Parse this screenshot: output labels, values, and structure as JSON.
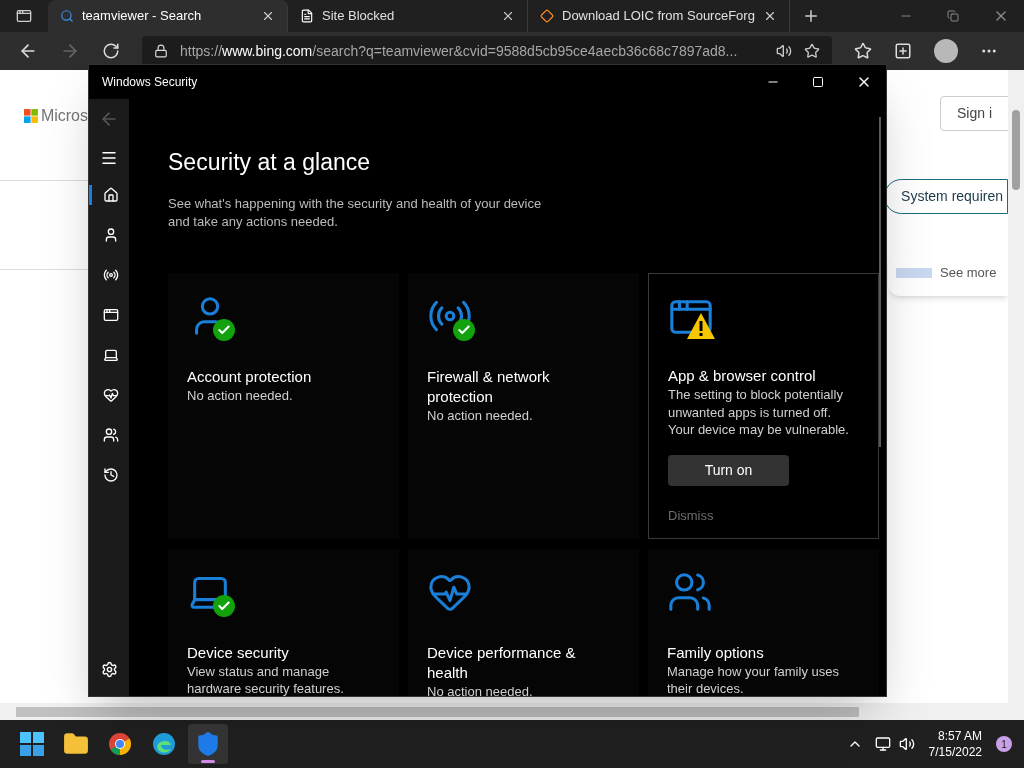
{
  "browser": {
    "tabs": [
      {
        "title": "teamviewer - Search",
        "kind": "search",
        "selected": true
      },
      {
        "title": "Site Blocked",
        "kind": "page",
        "selected": false
      },
      {
        "title": "Download LOIC from SourceForg",
        "kind": "diamond",
        "selected": false
      }
    ],
    "url": "https://**www.bing.com**/search?q=teamviewer&cvid=9588d5cb95ce4aecb36c68c7897ad8..."
  },
  "page": {
    "logo_text": "Micros",
    "sign_in": "Sign i",
    "system_button": "System requiren",
    "see_more": "See more"
  },
  "security": {
    "title": "Windows Security",
    "nav": [
      {
        "kind": "home",
        "selected": true
      },
      {
        "kind": "user",
        "selected": false
      },
      {
        "kind": "antenna",
        "selected": false
      },
      {
        "kind": "window",
        "selected": false
      },
      {
        "kind": "laptop",
        "selected": false
      },
      {
        "kind": "heart",
        "selected": false
      },
      {
        "kind": "family",
        "selected": false
      },
      {
        "kind": "history",
        "selected": false
      }
    ],
    "heading": "Security at a glance",
    "subtitle": [
      "See what's happening with the security and health of your device",
      "and take any actions needed."
    ],
    "cards": [
      {
        "kind": "user-ok",
        "title": [
          "Account protection"
        ],
        "body": [
          "No action needed."
        ]
      },
      {
        "kind": "antenna-ok",
        "title": [
          "Firewall & network",
          "protection"
        ],
        "body": [
          "No action needed."
        ]
      },
      {
        "kind": "window-warning",
        "title": [
          "App & browser control"
        ],
        "body": [
          "The setting to block potentially",
          "unwanted apps is turned off.",
          "Your device may be vulnerable."
        ],
        "button": "Turn on",
        "link": "Dismiss"
      },
      {
        "kind": "laptop-ok",
        "title": [
          "Device security"
        ],
        "body": [
          "View status and manage",
          "hardware security features."
        ]
      },
      {
        "kind": "heart",
        "title": [
          "Device performance &",
          "health"
        ],
        "body": [
          "No action needed."
        ]
      },
      {
        "kind": "family",
        "title": [
          "Family options"
        ],
        "body": [
          "Manage how your family uses",
          "their devices."
        ]
      }
    ]
  },
  "taskbar": {
    "apps": [
      {
        "kind": "start",
        "selected": false
      },
      {
        "kind": "folder",
        "selected": false
      },
      {
        "kind": "chrome",
        "selected": false
      },
      {
        "kind": "edge",
        "selected": false
      },
      {
        "kind": "shield",
        "selected": true
      }
    ],
    "time": "8:57 AM",
    "date": "7/15/2022",
    "notifications": "1"
  }
}
